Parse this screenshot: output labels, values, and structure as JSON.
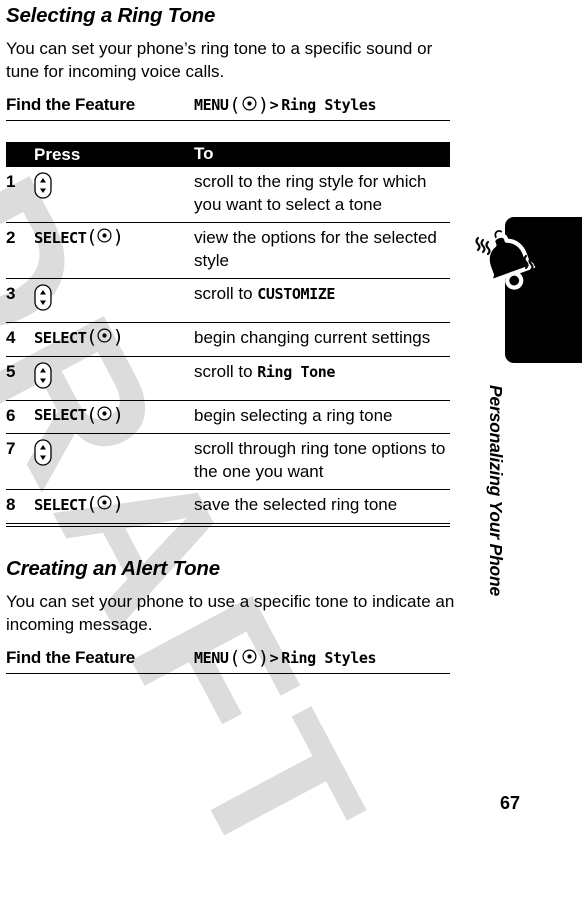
{
  "watermark": {
    "text": "DRAFT",
    "color": "#dcdcdc"
  },
  "page_number": "67",
  "side_tab": {
    "label": "Personalizing Your Phone",
    "icon": "ringing-bell-icon",
    "color": "#000000"
  },
  "sections": [
    {
      "title": "Selecting a Ring Tone",
      "body": "You can set your phone’s ring tone to a specific sound or tune for incoming voice calls.",
      "find_the_feature": {
        "label": "Find the Feature",
        "menu_word": "MENU",
        "separator": ">",
        "path": "Ring Styles"
      },
      "table": {
        "headers": {
          "number": "",
          "press": "Press",
          "to": "To"
        },
        "rows": [
          {
            "number": "1",
            "press_type": "nav-key",
            "press_label": "",
            "to_prefix": "scroll to the ring style for which you want to select a tone",
            "to_keyword": "",
            "to_suffix": ""
          },
          {
            "number": "2",
            "press_type": "select",
            "press_label": "SELECT",
            "to_prefix": "view the options for the selected style",
            "to_keyword": "",
            "to_suffix": ""
          },
          {
            "number": "3",
            "press_type": "nav-key",
            "press_label": "",
            "to_prefix": "scroll to ",
            "to_keyword": "CUSTOMIZE",
            "to_suffix": ""
          },
          {
            "number": "4",
            "press_type": "select",
            "press_label": "SELECT",
            "to_prefix": "begin changing current settings",
            "to_keyword": "",
            "to_suffix": ""
          },
          {
            "number": "5",
            "press_type": "nav-key",
            "press_label": "",
            "to_prefix": "scroll to ",
            "to_keyword": "Ring Tone",
            "to_suffix": ""
          },
          {
            "number": "6",
            "press_type": "select",
            "press_label": "SELECT",
            "to_prefix": "begin selecting a ring tone",
            "to_keyword": "",
            "to_suffix": ""
          },
          {
            "number": "7",
            "press_type": "nav-key",
            "press_label": "",
            "to_prefix": "scroll through ring tone options to the one you want",
            "to_keyword": "",
            "to_suffix": ""
          },
          {
            "number": "8",
            "press_type": "select",
            "press_label": "SELECT",
            "to_prefix": "save the selected ring tone",
            "to_keyword": "",
            "to_suffix": ""
          }
        ]
      }
    },
    {
      "title": "Creating an Alert Tone",
      "body": "You can set your phone to use a specific tone to indicate an incoming message.",
      "find_the_feature": {
        "label": "Find the Feature",
        "menu_word": "MENU",
        "separator": ">",
        "path": "Ring Styles"
      }
    }
  ]
}
